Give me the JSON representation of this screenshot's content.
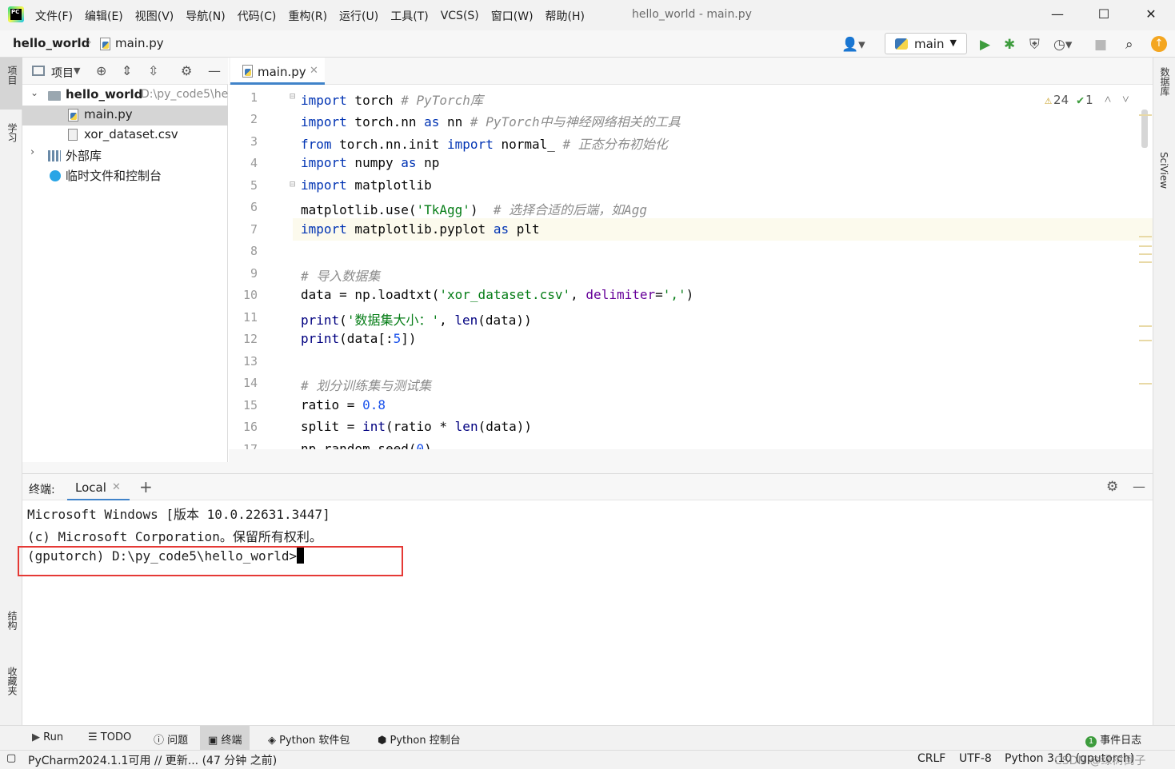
{
  "window": {
    "title": "hello_world - main.py",
    "menu": [
      "文件(F)",
      "编辑(E)",
      "视图(V)",
      "导航(N)",
      "代码(C)",
      "重构(R)",
      "运行(U)",
      "工具(T)",
      "VCS(S)",
      "窗口(W)",
      "帮助(H)"
    ],
    "minimize": "—",
    "maximize": "☐",
    "close": "✕"
  },
  "navbar": {
    "project": "hello_world",
    "file": "main.py",
    "run_config": "main"
  },
  "left_stripe": {
    "project": "项目",
    "learn": "学习",
    "structure": "结构",
    "favorites": "收藏夹"
  },
  "right_stripe": {
    "database": "数据库",
    "sciview": "SciView"
  },
  "project_panel": {
    "title": "项目",
    "tree": [
      {
        "label": "hello_world",
        "path": "D:\\py_code5\\he"
      },
      {
        "label": "main.py"
      },
      {
        "label": "xor_dataset.csv"
      },
      {
        "label": "外部库"
      },
      {
        "label": "临时文件和控制台"
      }
    ]
  },
  "editor": {
    "tab": "main.py",
    "warnings": "24",
    "checks": "1",
    "line_numbers": [
      "1",
      "2",
      "3",
      "4",
      "5",
      "6",
      "7",
      "8",
      "9",
      "10",
      "11",
      "12",
      "13",
      "14",
      "15",
      "16",
      "17"
    ]
  },
  "terminal": {
    "title": "终端:",
    "tab": "Local",
    "lines": [
      "Microsoft Windows [版本 10.0.22631.3447]",
      "(c) Microsoft Corporation。保留所有权利。",
      "(gputorch) D:\\py_code5\\hello_world>"
    ]
  },
  "tool_windows": {
    "run": "Run",
    "todo": "TODO",
    "problems": "问题",
    "terminal": "终端",
    "python_packages": "Python 软件包",
    "python_console": "Python 控制台",
    "event_log": "事件日志"
  },
  "statusbar": {
    "message": "PyCharm2024.1.1可用 // 更新... (47 分钟 之前)",
    "line_sep": "CRLF",
    "encoding": "UTF-8",
    "interpreter": "Python 3.10 (gputorch)",
    "watermark": "CSDN @绿树倒子"
  }
}
